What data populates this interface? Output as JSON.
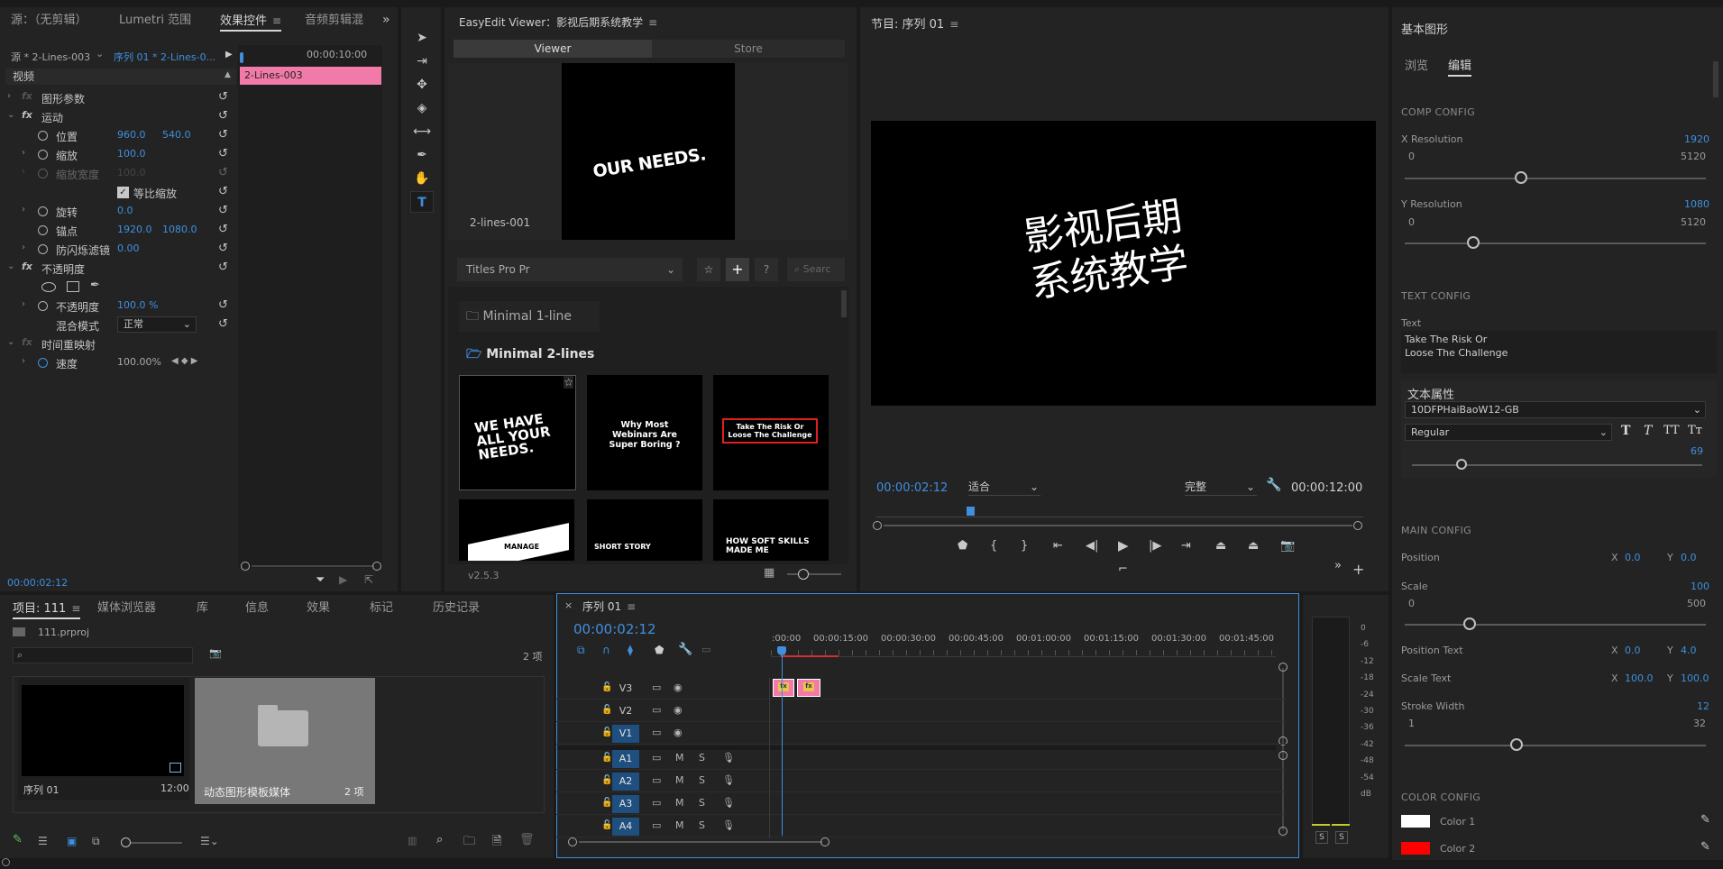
{
  "effect_controls": {
    "tabs": [
      "源：（无剪辑）",
      "Lumetri 范围",
      "效果控件",
      "音频剪辑混"
    ],
    "source": "源 * 2-Lines-003",
    "sequence": "序列 01 * 2-Lines-0...",
    "timecode_head": "00:00:10:00",
    "clip_label": "2-Lines-003",
    "video_label": "视频",
    "rows": {
      "graphic": "图形参数",
      "motion": "运动",
      "position": "位置",
      "pos_x": "960.0",
      "pos_y": "540.0",
      "scale": "缩放",
      "scale_v": "100.0",
      "scale_w": "缩放宽度",
      "scale_w_v": "100.0",
      "uniform": "等比缩放",
      "rotation": "旋转",
      "rotation_v": "0.0",
      "anchor": "锚点",
      "anchor_x": "1920.0",
      "anchor_y": "1080.0",
      "flicker": "防闪烁滤镜",
      "flicker_v": "0.00",
      "opacity": "不透明度",
      "opacity_item": "不透明度",
      "opacity_v": "100.0 %",
      "blend": "混合模式",
      "blend_v": "正常",
      "remap": "时间重映射",
      "speed": "速度",
      "speed_v": "100.00%"
    },
    "timecode": "00:00:02:12"
  },
  "easyedit": {
    "title": "EasyEdit Viewer：影视后期系统教学",
    "tabs": [
      "Viewer",
      "Store"
    ],
    "preview_text": "OUR NEEDS.",
    "preview_name": "2-lines-001",
    "dropdown": "Titles Pro Pr",
    "search_placeholder": "Searc",
    "folders": [
      "Minimal 1-line",
      "Minimal 2-lines"
    ],
    "thumbs": [
      "WE HAVE ALL YOUR NEEDS.",
      "Why Most Webinars Are Super Boring ?",
      "Take The Risk Or Loose The Challenge",
      "MANAGE",
      "SHORT STORY",
      "HOW SOFT SKILLS MADE ME"
    ],
    "version": "v2.5.3"
  },
  "program": {
    "title": "节目: 序列 01",
    "canvas_text": [
      "影视后期",
      "系统教学"
    ],
    "timecode": "00:00:02:12",
    "fit": "适合",
    "quality": "完整",
    "duration": "00:00:12:00"
  },
  "essential": {
    "title": "基本图形",
    "tabs": [
      "浏览",
      "编辑"
    ],
    "comp": "COMP CONFIG",
    "xres": "X Resolution",
    "xres_v": "1920",
    "xres_min": "0",
    "xres_max": "5120",
    "yres": "Y Resolution",
    "yres_v": "1080",
    "yres_min": "0",
    "yres_max": "5120",
    "text_config": "TEXT CONFIG",
    "text_lbl": "Text",
    "text_line1": "Take The Risk Or",
    "text_line2": "Loose The Challenge",
    "text_props": "文本属性",
    "font": "10DFPHaiBaoW12-GB",
    "style": "Regular",
    "font_size": "69",
    "main": "MAIN CONFIG",
    "position": "Position",
    "pos_x": "0.0",
    "pos_y": "0.0",
    "scale": "Scale",
    "scale_v": "100",
    "scale_min": "0",
    "scale_max": "500",
    "pos_text": "Position Text",
    "pt_x": "0.0",
    "pt_y": "4.0",
    "scale_text": "Scale Text",
    "st_x": "100.0",
    "st_y": "100.0",
    "stroke": "Stroke Width",
    "stroke_v": "12",
    "stroke_min": "1",
    "stroke_max": "32",
    "color_config": "COLOR CONFIG",
    "color1": "Color 1",
    "color2": "Color 2",
    "c1": "#ffffff",
    "c2": "#ff0000",
    "x": "X",
    "y": "Y"
  },
  "project": {
    "tabs": [
      "项目: 111",
      "媒体浏览器",
      "库",
      "信息",
      "效果",
      "标记",
      "历史记录"
    ],
    "file": "111.prproj",
    "count": "2 项",
    "items": [
      {
        "name": "序列 01",
        "meta": "12:00"
      },
      {
        "name": "动态图形模板媒体",
        "meta": "2 项"
      }
    ]
  },
  "timeline": {
    "title": "序列 01",
    "timecode": "00:00:02:12",
    "ruler": [
      ":00:00",
      "00:00:15:00",
      "00:00:30:00",
      "00:00:45:00",
      "00:01:00:00",
      "00:01:15:00",
      "00:01:30:00",
      "00:01:45:00"
    ],
    "video_tracks": [
      "V3",
      "V2",
      "V1"
    ],
    "audio_tracks": [
      "A1",
      "A2",
      "A3",
      "A4"
    ],
    "m": "M",
    "s": "S"
  },
  "meter": {
    "scale": [
      "0",
      "-6",
      "-12",
      "-18",
      "-24",
      "-30",
      "-36",
      "-42",
      "-48",
      "-54",
      "dB"
    ],
    "solo": [
      "S",
      "S"
    ]
  }
}
